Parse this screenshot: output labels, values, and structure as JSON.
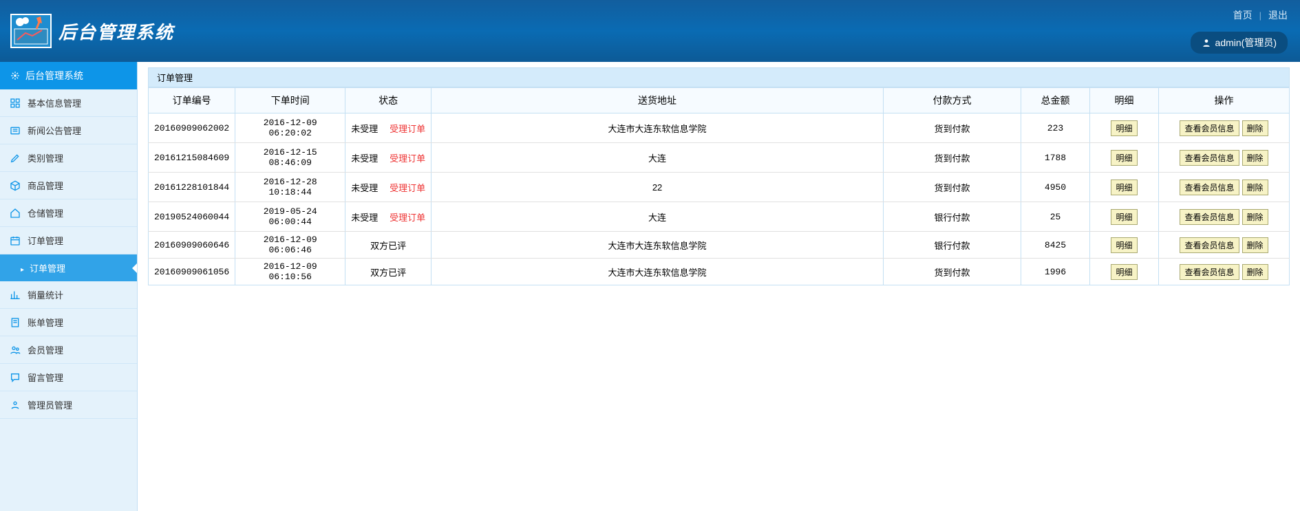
{
  "header": {
    "title": "后台管理系统",
    "home_link": "首页",
    "logout_link": "退出",
    "user_label": "admin(管理员)"
  },
  "sidebar": {
    "title": "后台管理系统",
    "items": [
      {
        "icon": "grid",
        "label": "基本信息管理"
      },
      {
        "icon": "news",
        "label": "新闻公告管理"
      },
      {
        "icon": "edit",
        "label": "类别管理"
      },
      {
        "icon": "cube",
        "label": "商品管理"
      },
      {
        "icon": "home",
        "label": "仓储管理"
      },
      {
        "icon": "calendar",
        "label": "订单管理",
        "sub": [
          {
            "label": "订单管理"
          }
        ]
      },
      {
        "icon": "chart",
        "label": "销量统计"
      },
      {
        "icon": "bill",
        "label": "账单管理"
      },
      {
        "icon": "users",
        "label": "会员管理"
      },
      {
        "icon": "message",
        "label": "留言管理"
      },
      {
        "icon": "admin",
        "label": "管理员管理"
      }
    ]
  },
  "panel": {
    "title": "订单管理"
  },
  "table": {
    "headers": {
      "order_id": "订单编号",
      "order_time": "下单时间",
      "status": "状态",
      "address": "送货地址",
      "pay_method": "付款方式",
      "amount": "总金额",
      "detail": "明细",
      "action": "操作"
    },
    "status_pending": "未受理",
    "status_action": "受理订单",
    "status_done": "双方已评",
    "detail_btn": "明细",
    "view_member_btn": "查看会员信息",
    "delete_btn": "删除",
    "rows": [
      {
        "id": "20160909062002",
        "time": "2016-12-09 06:20:02",
        "status_type": "pending",
        "address": "大连市大连东软信息学院",
        "pay": "货到付款",
        "amount": "223"
      },
      {
        "id": "20161215084609",
        "time": "2016-12-15 08:46:09",
        "status_type": "pending",
        "address": "大连",
        "pay": "货到付款",
        "amount": "1788"
      },
      {
        "id": "20161228101844",
        "time": "2016-12-28 10:18:44",
        "status_type": "pending",
        "address": "22",
        "pay": "货到付款",
        "amount": "4950"
      },
      {
        "id": "20190524060044",
        "time": "2019-05-24 06:00:44",
        "status_type": "pending",
        "address": "大连",
        "pay": "银行付款",
        "amount": "25"
      },
      {
        "id": "20160909060646",
        "time": "2016-12-09 06:06:46",
        "status_type": "done",
        "address": "大连市大连东软信息学院",
        "pay": "银行付款",
        "amount": "8425"
      },
      {
        "id": "20160909061056",
        "time": "2016-12-09 06:10:56",
        "status_type": "done",
        "address": "大连市大连东软信息学院",
        "pay": "货到付款",
        "amount": "1996"
      }
    ]
  }
}
